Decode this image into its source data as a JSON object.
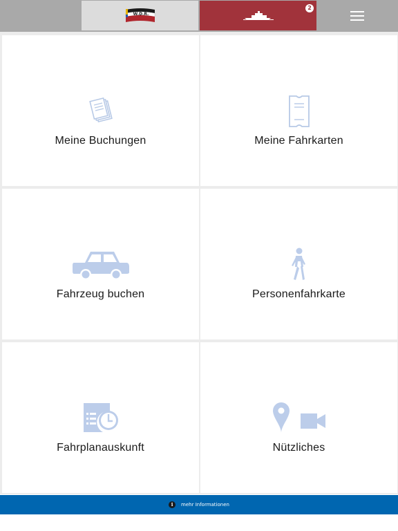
{
  "header": {
    "logo_text": "W.D.R.",
    "cart_count": "2",
    "colors": {
      "active": "#a1333b",
      "bar": "#a9a9a9",
      "logo_bg": "#dcdcdc"
    }
  },
  "tiles": [
    {
      "label": "Meine Buchungen",
      "icon": "documents-icon"
    },
    {
      "label": "Meine Fahrkarten",
      "icon": "ticket-icon"
    },
    {
      "label": "Fahrzeug buchen",
      "icon": "car-icon"
    },
    {
      "label": "Personenfahrkarte",
      "icon": "pedestrian-icon"
    },
    {
      "label": "Fahrplanauskunft",
      "icon": "timetable-icon"
    },
    {
      "label": "Nützliches",
      "icon": "location-video-icon"
    }
  ],
  "footer": {
    "info_glyph": "i",
    "text": "mehr Informationen",
    "color": "#0066b0"
  },
  "icon_color": "#bfd0ea"
}
